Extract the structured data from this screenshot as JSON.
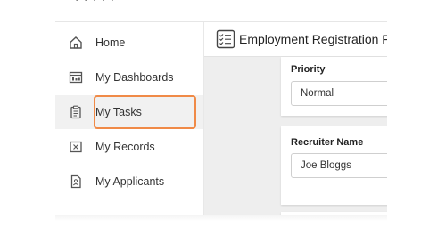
{
  "sidebar": {
    "items": [
      {
        "label": "Home",
        "icon": "home-icon"
      },
      {
        "label": "My Dashboards",
        "icon": "dashboard-icon"
      },
      {
        "label": "My Tasks",
        "icon": "clipboard-icon",
        "active": true
      },
      {
        "label": "My Records",
        "icon": "records-icon"
      },
      {
        "label": "My Applicants",
        "icon": "applicants-icon"
      }
    ]
  },
  "header": {
    "title": "Employment Registration F",
    "icon": "checklist-icon"
  },
  "form": {
    "priority": {
      "label": "Priority",
      "value": "Normal"
    },
    "recruiter": {
      "label": "Recruiter Name",
      "value": "Joe Bloggs"
    }
  },
  "colors": {
    "highlight": "#f08a47",
    "active_bg": "#f1f1f1",
    "main_bg": "#eeeeee"
  }
}
